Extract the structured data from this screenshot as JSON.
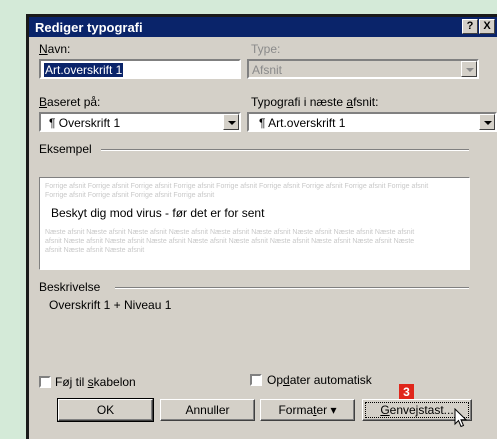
{
  "dialog": {
    "title": "Rediger typografi",
    "help_glyph": "?",
    "close_glyph": "X"
  },
  "name_field": {
    "label_pre": "",
    "label_ul": "N",
    "label_post": "avn:",
    "value": "Art.overskrift 1"
  },
  "type_field": {
    "label": "Type:",
    "value": "Afsnit"
  },
  "based_on": {
    "label_pre": "",
    "label_ul": "B",
    "label_post": "aseret på:",
    "value": "¶ Overskrift 1"
  },
  "next_style": {
    "label_pre": "Typografi i næste ",
    "label_ul": "a",
    "label_post": "fsnit:",
    "value": "¶ Art.overskrift 1"
  },
  "example": {
    "group_label": "Eksempel",
    "ghost_before": [
      "Forrige afsnit Forrige afsnit Forrige afsnit Forrige afsnit Forrige afsnit Forrige afsnit Forrige afsnit Forrige afsnit Forrige afsnit",
      "Forrige afsnit Forrige afsnit Forrige afsnit Forrige afsnit"
    ],
    "sample_text": "Beskyt dig mod virus - før det er for sent",
    "ghost_after": [
      "Næste afsnit Næste afsnit Næste afsnit Næste afsnit Næste afsnit Næste afsnit Næste afsnit Næste afsnit Næste afsnit",
      "afsnit Næste afsnit Næste afsnit Næste afsnit Næste afsnit Næste afsnit Næste afsnit Næste afsnit Næste afsnit Næste",
      "afsnit Næste afsnit Næste afsnit"
    ]
  },
  "description": {
    "group_label": "Beskrivelse",
    "text": "Overskrift 1 + Niveau 1"
  },
  "checkboxes": {
    "add_template": {
      "label_pre": "Føj til ",
      "label_ul": "s",
      "label_post": "kabelon",
      "checked": false
    },
    "auto_update": {
      "label_pre": "Op",
      "label_ul": "d",
      "label_post": "ater automatisk",
      "checked": false
    }
  },
  "buttons": {
    "ok": "OK",
    "cancel": "Annuller",
    "format_pre": "Forma",
    "format_ul": "t",
    "format_post": "er",
    "format_arrow": "▾",
    "shortcut_ul": "G",
    "shortcut_post": "envejstast..."
  },
  "annotation": {
    "step": "3",
    "color": "#e0261b"
  },
  "colors": {
    "titlebar": "#0a246a",
    "dialog": "#d4d0c8",
    "background": "#d4ead8"
  }
}
